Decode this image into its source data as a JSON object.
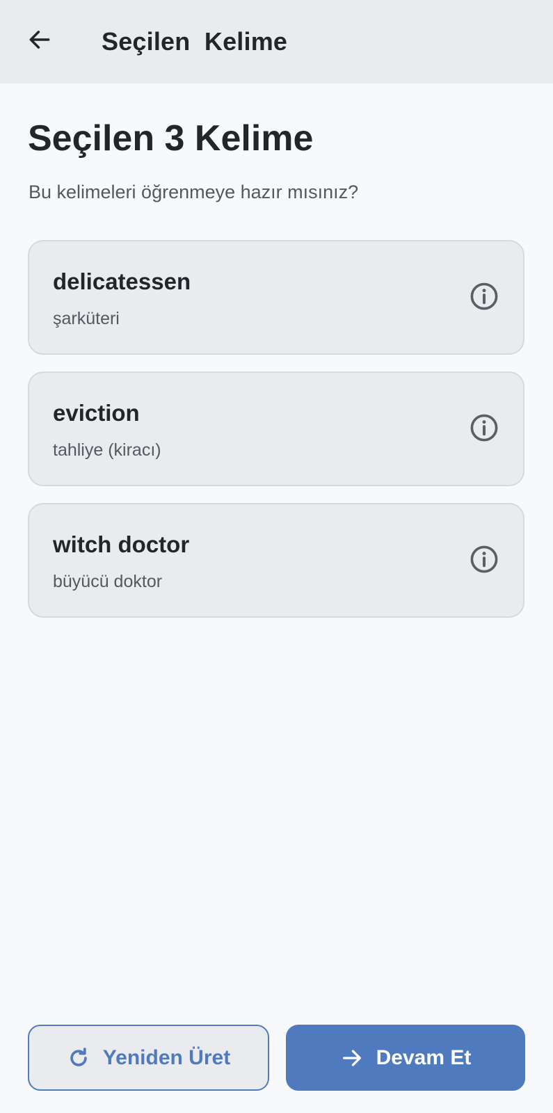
{
  "appbar": {
    "title": "Seçilen  Kelime",
    "back_icon": "arrow-left-icon"
  },
  "header": {
    "heading": "Seçilen 3 Kelime",
    "subheading": "Bu kelimeleri öğrenmeye hazır mısınız?"
  },
  "words": [
    {
      "term": "delicatessen",
      "meaning": "şarküteri",
      "icon": "info-icon"
    },
    {
      "term": "eviction",
      "meaning": "tahliye (kiracı)",
      "icon": "info-icon"
    },
    {
      "term": "witch doctor",
      "meaning": "büyücü doktor",
      "icon": "info-icon"
    }
  ],
  "actions": {
    "regenerate_label": "Yeniden Üret",
    "regenerate_icon": "refresh-icon",
    "continue_label": "Devam Et",
    "continue_icon": "arrow-right-icon"
  },
  "colors": {
    "accent": "#4f7bbe",
    "background": "#f8f9fb",
    "appbar": "#e9ebee",
    "card": "#e9ebee",
    "text": "#22252a",
    "muted_text": "#55595f"
  }
}
